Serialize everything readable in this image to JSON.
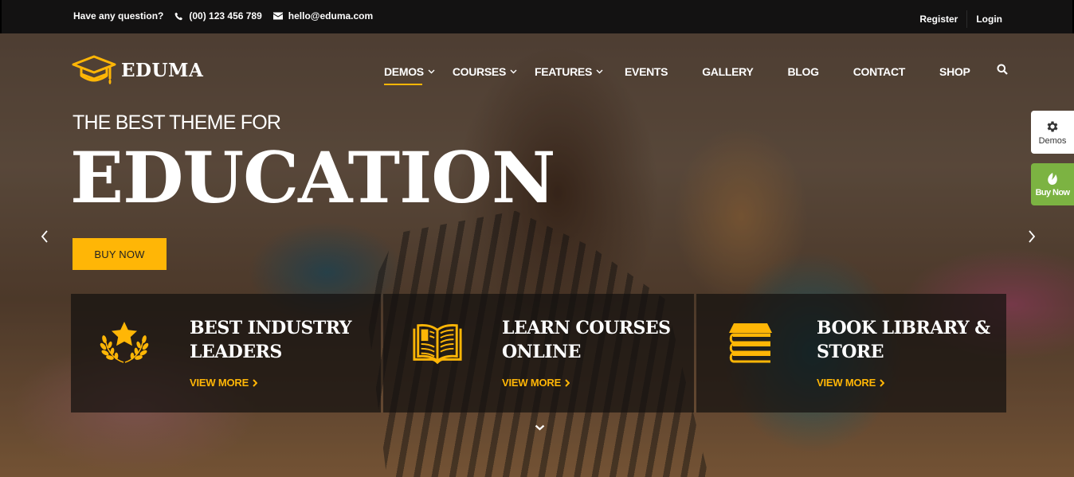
{
  "topbar": {
    "question": "Have any question?",
    "phone": "(00) 123 456 789",
    "email": "hello@eduma.com",
    "register": "Register",
    "login": "Login"
  },
  "header": {
    "logo_text": "EDUMA",
    "nav": [
      {
        "label": "DEMOS",
        "dropdown": true,
        "active": true
      },
      {
        "label": "COURSES",
        "dropdown": true
      },
      {
        "label": "FEATURES",
        "dropdown": true
      },
      {
        "label": "EVENTS"
      },
      {
        "label": "GALLERY"
      },
      {
        "label": "BLOG"
      },
      {
        "label": "CONTACT"
      },
      {
        "label": "SHOP"
      }
    ]
  },
  "hero": {
    "subtitle": "THE BEST THEME FOR",
    "title": "EDUCATION",
    "button": "BUY NOW"
  },
  "side": {
    "demos": "Demos",
    "buy_now": "Buy Now"
  },
  "features": [
    {
      "line1": "BEST INDUSTRY",
      "line2": "LEADERS",
      "link": "VIEW MORE",
      "icon": "star-laurel-icon"
    },
    {
      "line1": "LEARN COURSES",
      "line2": "ONLINE",
      "link": "VIEW MORE",
      "icon": "open-book-icon"
    },
    {
      "line1": "BOOK LIBRARY &",
      "line2": "STORE",
      "link": "VIEW MORE",
      "icon": "book-stack-icon"
    }
  ],
  "colors": {
    "accent": "#ffb606",
    "topbar_bg": "#131212",
    "buy_now_green": "#7cb342"
  }
}
